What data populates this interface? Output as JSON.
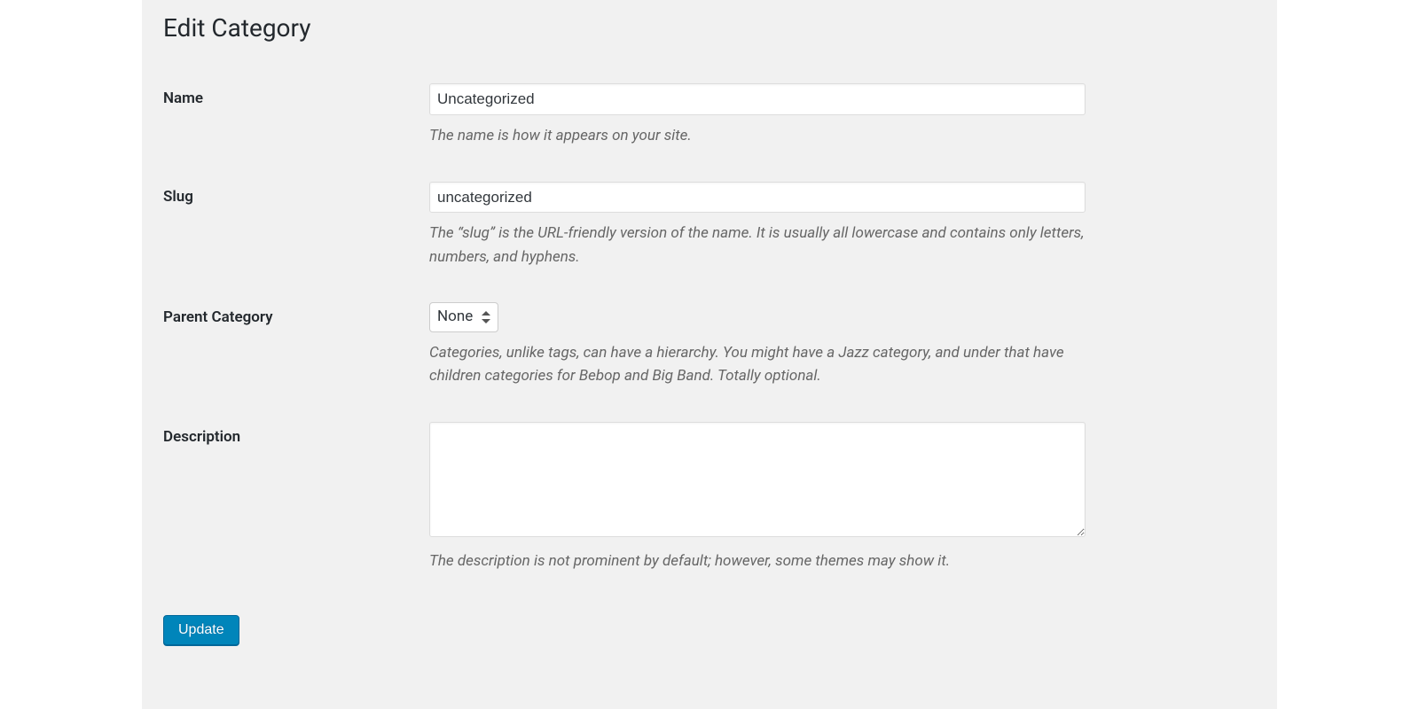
{
  "page": {
    "title": "Edit Category"
  },
  "fields": {
    "name": {
      "label": "Name",
      "value": "Uncategorized",
      "help": "The name is how it appears on your site."
    },
    "slug": {
      "label": "Slug",
      "value": "uncategorized",
      "help": "The “slug” is the URL-friendly version of the name. It is usually all lowercase and contains only letters, numbers, and hyphens."
    },
    "parent": {
      "label": "Parent Category",
      "selected": "None",
      "help": "Categories, unlike tags, can have a hierarchy. You might have a Jazz category, and under that have children categories for Bebop and Big Band. Totally optional."
    },
    "description": {
      "label": "Description",
      "value": "",
      "help": "The description is not prominent by default; however, some themes may show it."
    }
  },
  "actions": {
    "submit_label": "Update"
  }
}
